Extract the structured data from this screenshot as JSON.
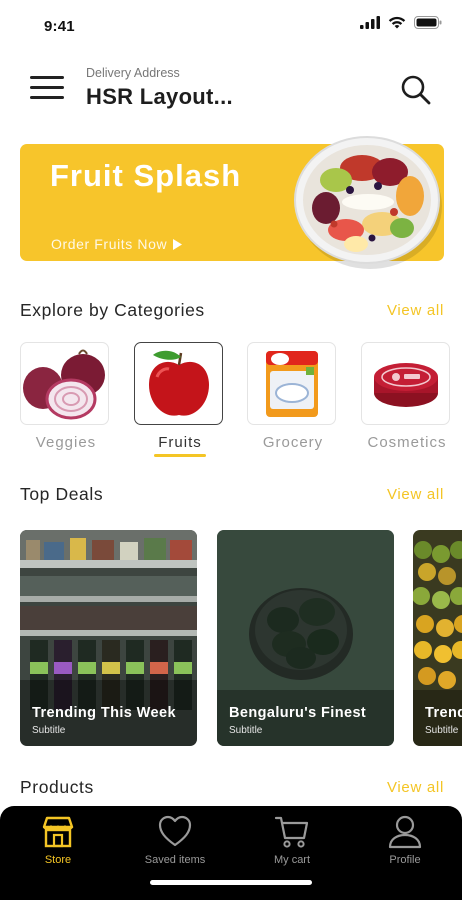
{
  "status": {
    "time": "9:41"
  },
  "header": {
    "caption": "Delivery Address",
    "address": "HSR Layout..."
  },
  "banner": {
    "title": "Fruit Splash",
    "cta": "Order Fruits Now"
  },
  "categories_section": {
    "title": "Explore by Categories",
    "view_all": "View all",
    "items": [
      {
        "label": "Veggies",
        "active": false
      },
      {
        "label": "Fruits",
        "active": true
      },
      {
        "label": "Grocery",
        "active": false
      },
      {
        "label": "Cosmetics",
        "active": false
      }
    ]
  },
  "deals_section": {
    "title": "Top Deals",
    "view_all": "View all",
    "items": [
      {
        "title": "Trending This Week",
        "subtitle": "Subtitle"
      },
      {
        "title": "Bengaluru's Finest",
        "subtitle": "Subtitle"
      },
      {
        "title": "Trending This Week",
        "subtitle": "Subtitle"
      }
    ]
  },
  "products_section": {
    "title": "Products",
    "view_all": "View all"
  },
  "bottom_nav": {
    "items": [
      {
        "label": "Store",
        "icon": "store-icon",
        "active": true
      },
      {
        "label": "Saved items",
        "icon": "heart-icon",
        "active": false
      },
      {
        "label": "My cart",
        "icon": "cart-icon",
        "active": false
      },
      {
        "label": "Profile",
        "icon": "profile-icon",
        "active": false
      }
    ]
  },
  "colors": {
    "accent": "#f4c525",
    "banner": "#f7c52b",
    "nav_background": "#000000"
  }
}
